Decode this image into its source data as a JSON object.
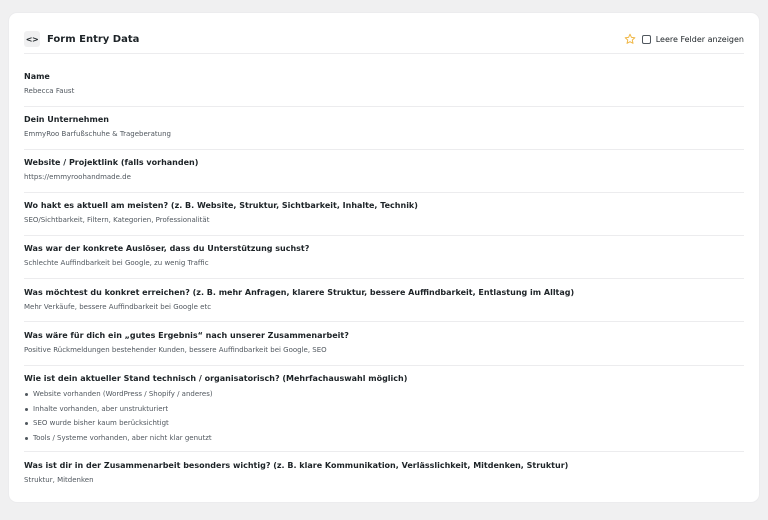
{
  "header": {
    "title": "Form Entry Data",
    "code_icon": "<>",
    "toggle_label": "Leere Felder anzeigen",
    "star_color": "#f0b849"
  },
  "fields": [
    {
      "label": "Name",
      "value": "Rebecca Faust"
    },
    {
      "label": "Dein Unternehmen",
      "value": "EmmyRoo Barfußschuhe & Trageberatung"
    },
    {
      "label": "Website / Projektlink (falls vorhanden)",
      "value": "https://emmyroohandmade.de"
    },
    {
      "label": "Wo hakt es aktuell am meisten? (z. B. Website, Struktur, Sichtbarkeit, Inhalte, Technik)",
      "value": "SEO/Sichtbarkeit, Filtern, Kategorien, Professionalität"
    },
    {
      "label": "Was war der konkrete Auslöser, dass du Unterstützung suchst?",
      "value": "Schlechte Auffindbarkeit bei Google, zu wenig Traffic"
    },
    {
      "label": "Was möchtest du konkret erreichen? (z. B. mehr Anfragen, klarere Struktur, bessere Auffindbarkeit, Entlastung im Alltag)",
      "value": "Mehr Verkäufe, bessere Auffindbarkeit bei Google etc"
    },
    {
      "label": "Was wäre für dich ein „gutes Ergebnis“ nach unserer Zusammenarbeit?",
      "value": "Positive Rückmeldungen bestehender Kunden, bessere Auffindbarkeit bei Google, SEO"
    },
    {
      "label": "Wie ist dein aktueller Stand technisch / organisatorisch? (Mehrfachauswahl möglich)",
      "items": [
        "Website vorhanden (WordPress / Shopify / anderes)",
        "Inhalte vorhanden, aber unstrukturiert",
        "SEO wurde bisher kaum berücksichtigt",
        "Tools / Systeme vorhanden, aber nicht klar genutzt"
      ]
    },
    {
      "label": "Was ist dir in der Zusammenarbeit besonders wichtig? (z. B. klare Kommunikation, Verlässlichkeit, Mitdenken, Struktur)",
      "value": "Struktur, Mitdenken"
    }
  ]
}
